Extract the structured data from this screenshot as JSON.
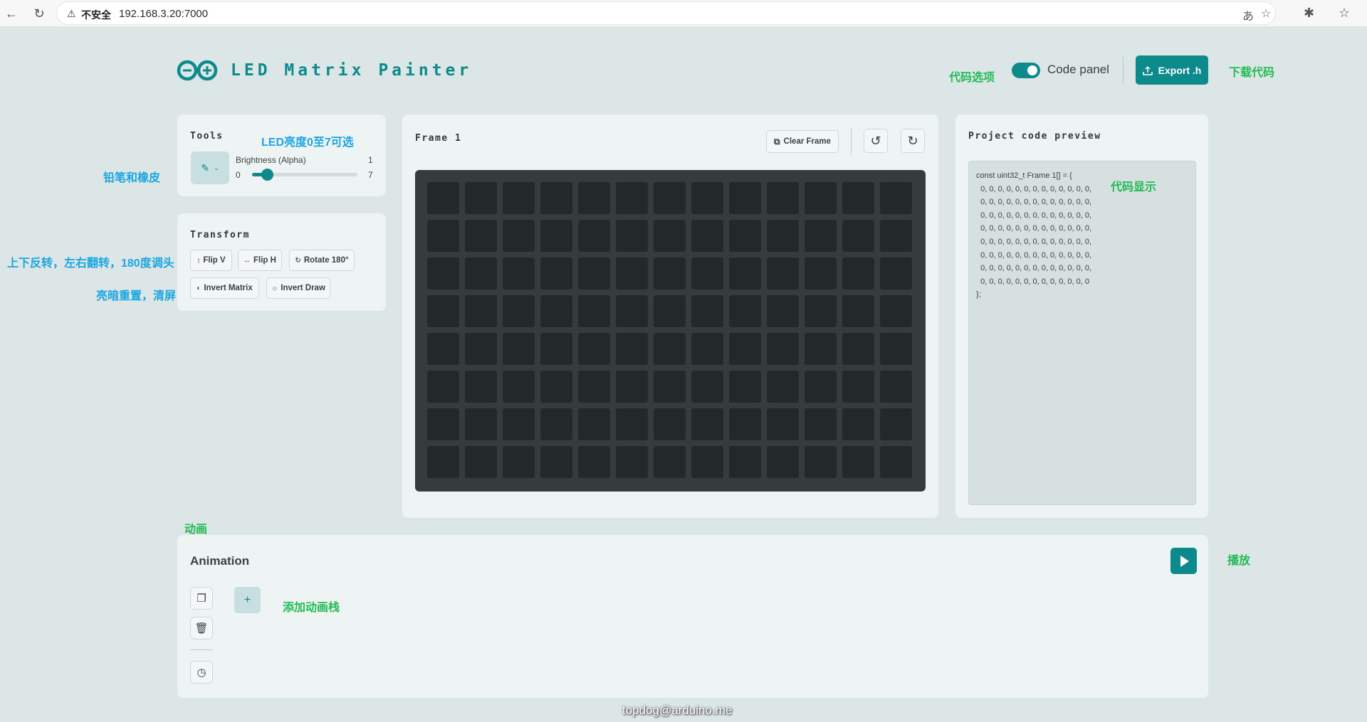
{
  "browser": {
    "insecure_label": "不安全",
    "url": "192.168.3.20:7000"
  },
  "header": {
    "title": "LED Matrix Painter",
    "code_panel_label": "Code panel",
    "code_panel_on": true,
    "export_label": "Export .h"
  },
  "annotations": {
    "code_options": "代码选项",
    "download_code": "下载代码",
    "brightness_note": "LED亮度0至7可选",
    "pencil_eraser": "铅笔和橡皮",
    "flip_rotate": "上下反转，左右翻转，180度调头",
    "invert_clear": "亮暗重置，清屏",
    "code_display": "代码显示",
    "animation": "动画",
    "play": "播放",
    "add_frame": "添加动画栈"
  },
  "tools": {
    "title": "Tools",
    "brightness_label": "Brightness (Alpha)",
    "brightness_value": "1",
    "brightness_min": "0",
    "brightness_max": "7",
    "brightness_fraction": 0.143
  },
  "transform": {
    "title": "Transform",
    "flip_v": "Flip V",
    "flip_h": "Flip H",
    "rotate": "Rotate 180°",
    "invert_matrix": "Invert Matrix",
    "invert_draw": "Invert Draw"
  },
  "frame": {
    "title": "Frame 1",
    "clear_label": "Clear Frame",
    "columns": 13,
    "rows": 8
  },
  "code": {
    "title": "Project code preview",
    "text": "const uint32_t Frame 1[] = {\n  0, 0, 0, 0, 0, 0, 0, 0, 0, 0, 0, 0, 0,\n  0, 0, 0, 0, 0, 0, 0, 0, 0, 0, 0, 0, 0,\n  0, 0, 0, 0, 0, 0, 0, 0, 0, 0, 0, 0, 0,\n  0, 0, 0, 0, 0, 0, 0, 0, 0, 0, 0, 0, 0,\n  0, 0, 0, 0, 0, 0, 0, 0, 0, 0, 0, 0, 0,\n  0, 0, 0, 0, 0, 0, 0, 0, 0, 0, 0, 0, 0,\n  0, 0, 0, 0, 0, 0, 0, 0, 0, 0, 0, 0, 0,\n  0, 0, 0, 0, 0, 0, 0, 0, 0, 0, 0, 0, 0\n};"
  },
  "animation": {
    "title": "Animation",
    "add_label": "+"
  },
  "watermark": "topdog@arduino.me"
}
